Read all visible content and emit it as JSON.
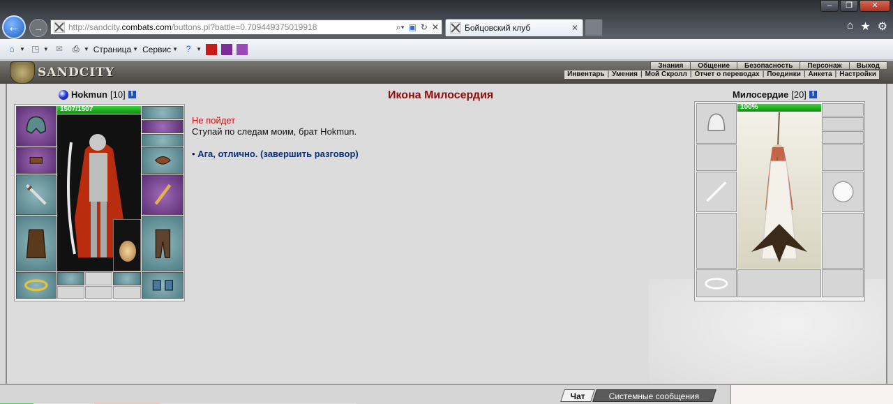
{
  "browser": {
    "url_prefix": "http://sandcity.",
    "url_domain": "combats.com",
    "url_path": "/buttons.pl?battle=0.709449375019918",
    "tab_title": "Бойцовский клуб",
    "menu_page": "Страница",
    "menu_service": "Сервис"
  },
  "game": {
    "logo_text": "SANDCITY",
    "top_menu": [
      "Знания",
      "Общение",
      "Безопасность",
      "Персонаж",
      "Выход"
    ],
    "sub_menu": [
      "Инвентарь",
      "Умения",
      "Мой Скролл",
      "Отчет о переводах",
      "Поединки",
      "Анкета",
      "Настройки"
    ]
  },
  "player": {
    "name": "Hokmun",
    "level": "[10]",
    "hp_text": "1507/1507",
    "hp_fraction": 1.0
  },
  "npc": {
    "name": "Милосердие",
    "level": "[20]",
    "hp_text": "100%",
    "hp_fraction": 1.0
  },
  "dialog": {
    "title": "Икона Милосердия",
    "status": "Не пойдет",
    "speech": "Ступай по следам моим, брат Hokmun.",
    "reply_bullet": "•",
    "reply": "Ага, отлично. (завершить разговор)"
  },
  "bottom": {
    "tab_chat": "Чат",
    "tab_system": "Системные сообщения"
  },
  "colors": {
    "dialog_title": "#8b0d0d",
    "status": "#d01010",
    "reply_link": "#0b2f7a",
    "hp_green": "#1f9f1f"
  }
}
